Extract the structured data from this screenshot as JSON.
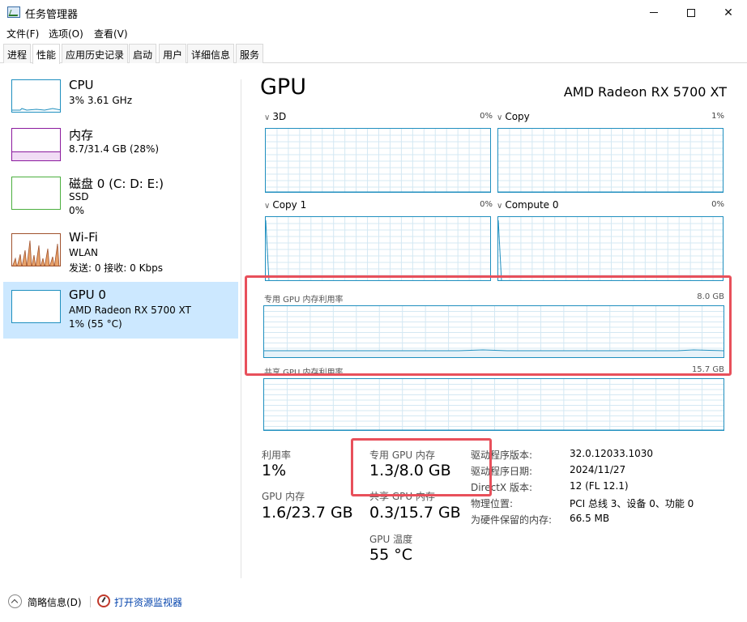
{
  "window": {
    "title": "任务管理器"
  },
  "menu": [
    "文件(F)",
    "选项(O)",
    "查看(V)"
  ],
  "tabs": [
    "进程",
    "性能",
    "应用历史记录",
    "启动",
    "用户",
    "详细信息",
    "服务"
  ],
  "active_tab": "性能",
  "sidebar": {
    "items": [
      {
        "name": "CPU",
        "line1": "3%  3.61 GHz",
        "line2": "",
        "color": "#1f8fbf"
      },
      {
        "name": "内存",
        "line1": "8.7/31.4 GB (28%)",
        "line2": "",
        "color": "#8b1a9e"
      },
      {
        "name": "磁盘 0 (C: D: E:)",
        "line1": "SSD",
        "line2": "0%",
        "color": "#4caf3f"
      },
      {
        "name": "Wi-Fi",
        "line1": "WLAN",
        "line2": "发送: 0 接收: 0 Kbps",
        "color": "#a0522d"
      },
      {
        "name": "GPU 0",
        "line1": "AMD Radeon RX 5700 XT",
        "line2": "1% (55 °C)",
        "color": "#1f8fbf"
      }
    ]
  },
  "main": {
    "title": "GPU",
    "model": "AMD Radeon RX 5700 XT",
    "engines": [
      {
        "label": "3D",
        "pct": "0%"
      },
      {
        "label": "Copy",
        "pct": "1%"
      },
      {
        "label": "Copy 1",
        "pct": "0%"
      },
      {
        "label": "Compute 0",
        "pct": "0%"
      }
    ],
    "dedicated_mem": {
      "label": "专用 GPU 内存利用率",
      "max": "8.0 GB"
    },
    "shared_mem": {
      "label": "共享 GPU 内存利用率",
      "max": "15.7 GB"
    },
    "stats": {
      "utilization": {
        "label": "利用率",
        "value": "1%"
      },
      "gpu_memory": {
        "label": "GPU 内存",
        "value": "1.6/23.7 GB"
      },
      "dedicated": {
        "label": "专用 GPU 内存",
        "value": "1.3/8.0 GB"
      },
      "shared": {
        "label": "共享 GPU 内存",
        "value": "0.3/15.7 GB"
      },
      "temperature": {
        "label": "GPU 温度",
        "value": "55 °C"
      }
    },
    "info": [
      {
        "key": "驱动程序版本:",
        "value": "32.0.12033.1030"
      },
      {
        "key": "驱动程序日期:",
        "value": "2024/11/27"
      },
      {
        "key": "DirectX 版本:",
        "value": "12 (FL 12.1)"
      },
      {
        "key": "物理位置:",
        "value": "PCI 总线 3、设备 0、功能 0"
      },
      {
        "key": "为硬件保留的内存:",
        "value": "66.5 MB"
      }
    ]
  },
  "footer": {
    "summary": "简略信息(D)",
    "resource_monitor": "打开资源监视器"
  },
  "colors": {
    "accent": "#1f8fbf",
    "selected": "#cce8ff",
    "highlight": "#e8505b"
  }
}
